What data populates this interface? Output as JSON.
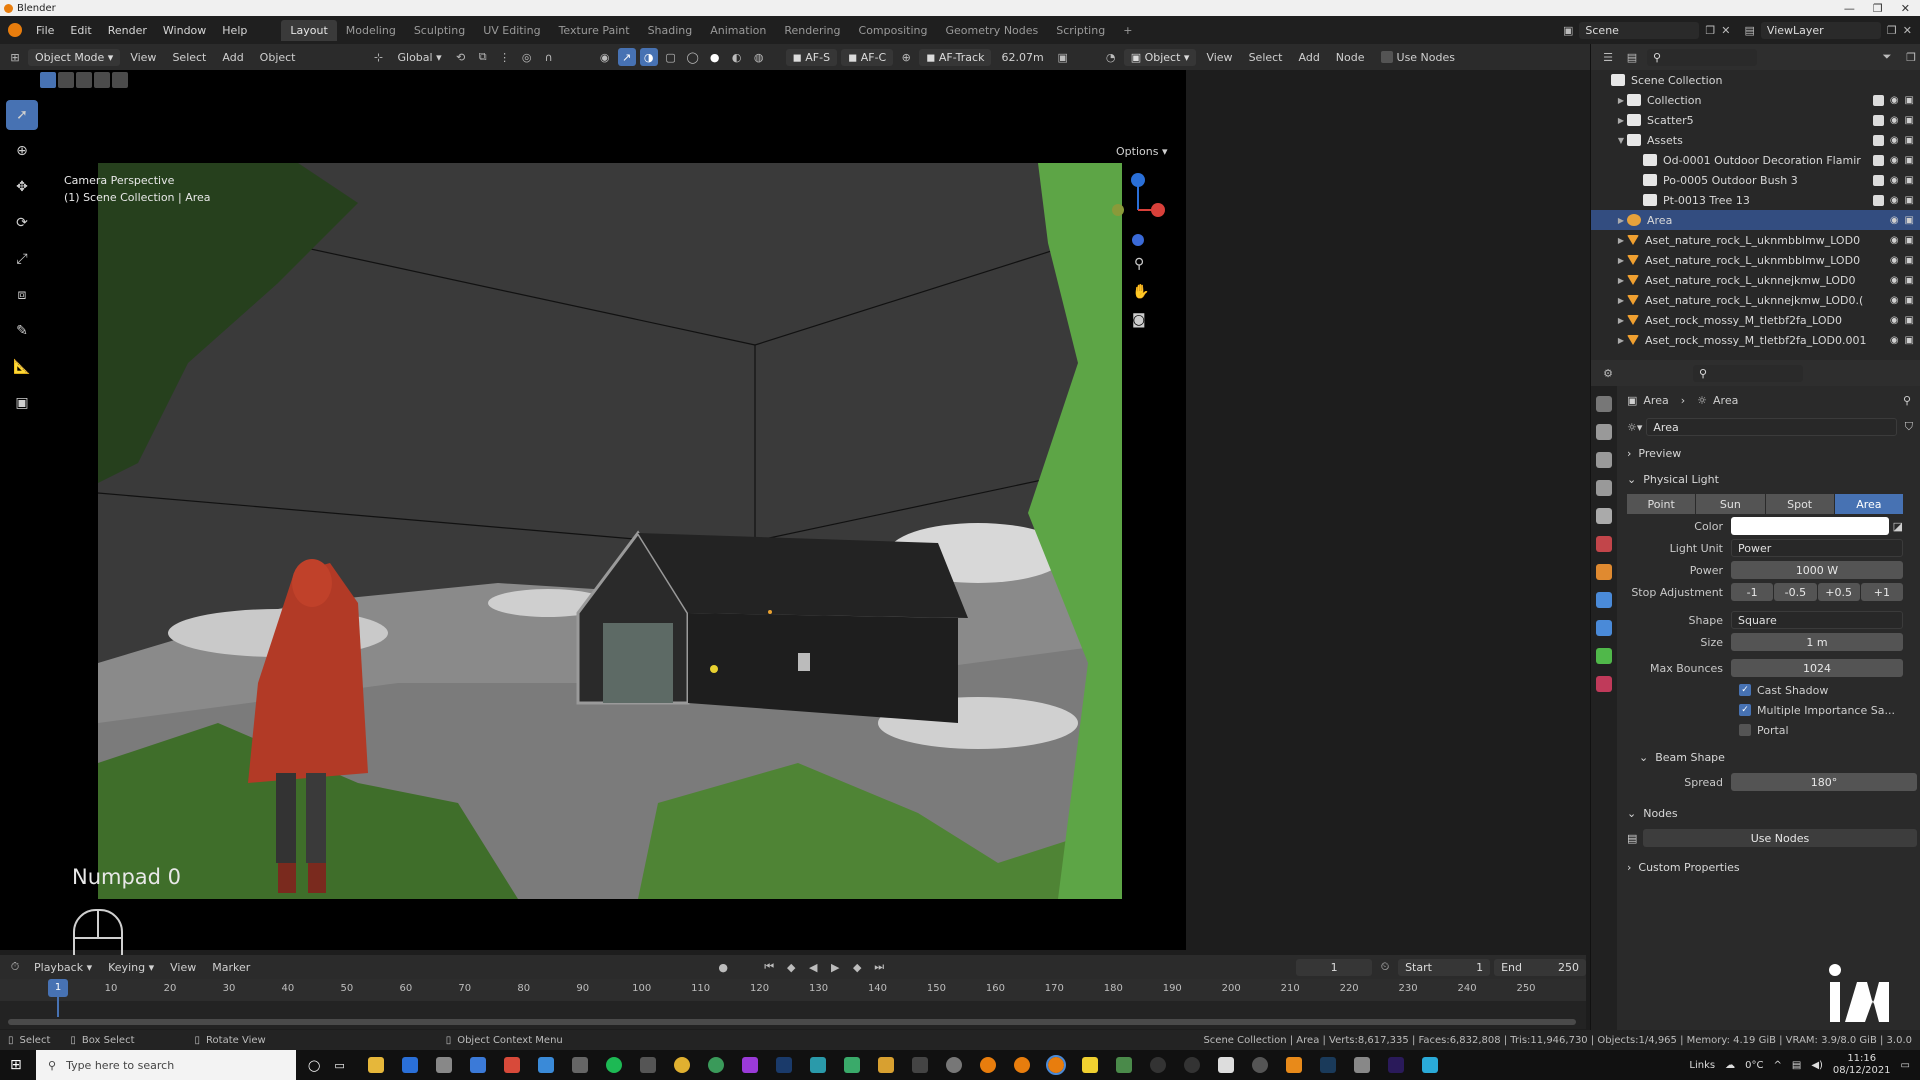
{
  "app": {
    "title": "Blender"
  },
  "menu": {
    "items": [
      "File",
      "Edit",
      "Render",
      "Window",
      "Help"
    ],
    "workspaces": [
      "Layout",
      "Modeling",
      "Sculpting",
      "UV Editing",
      "Texture Paint",
      "Shading",
      "Animation",
      "Rendering",
      "Compositing",
      "Geometry Nodes",
      "Scripting"
    ],
    "active_workspace": "Layout",
    "scene": "Scene",
    "view_layer": "ViewLayer"
  },
  "viewport_header": {
    "mode": "Object Mode",
    "menus": [
      "View",
      "Select",
      "Add",
      "Object"
    ],
    "orientation": "Global",
    "af_s": "AF-S",
    "af_c": "AF-C",
    "af_track": "AF-Track",
    "distance": "62.07m",
    "object_dropdown": "Object",
    "right_menus": [
      "View",
      "Select",
      "Add",
      "Node"
    ],
    "use_nodes": "Use Nodes",
    "options": "Options"
  },
  "viewport": {
    "line1": "Camera Perspective",
    "line2": "(1) Scene Collection | Area",
    "numpad": "Numpad 0"
  },
  "outliner": {
    "rows": [
      {
        "label": "Scene Collection",
        "depth": 0,
        "type": "collection",
        "selected": false
      },
      {
        "label": "Collection",
        "depth": 1,
        "type": "collection",
        "selected": false
      },
      {
        "label": "Scatter5",
        "depth": 1,
        "type": "collection",
        "selected": false
      },
      {
        "label": "Assets",
        "depth": 1,
        "type": "collection",
        "selected": false
      },
      {
        "label": "Od-0001 Outdoor Decoration Flamir",
        "depth": 2,
        "type": "collection",
        "selected": false
      },
      {
        "label": "Po-0005 Outdoor Bush 3",
        "depth": 2,
        "type": "collection",
        "selected": false
      },
      {
        "label": "Pt-0013 Tree 13",
        "depth": 2,
        "type": "collection",
        "selected": false
      },
      {
        "label": "Area",
        "depth": 1,
        "type": "light",
        "selected": true
      },
      {
        "label": "Aset_nature_rock_L_uknmbblmw_LOD0",
        "depth": 1,
        "type": "mesh",
        "selected": false
      },
      {
        "label": "Aset_nature_rock_L_uknmbblmw_LOD0",
        "depth": 1,
        "type": "mesh",
        "selected": false
      },
      {
        "label": "Aset_nature_rock_L_uknnejkmw_LOD0",
        "depth": 1,
        "type": "mesh",
        "selected": false
      },
      {
        "label": "Aset_nature_rock_L_uknnejkmw_LOD0.(",
        "depth": 1,
        "type": "mesh",
        "selected": false
      },
      {
        "label": "Aset_rock_mossy_M_tletbf2fa_LOD0",
        "depth": 1,
        "type": "mesh",
        "selected": false
      },
      {
        "label": "Aset_rock_mossy_M_tletbf2fa_LOD0.001",
        "depth": 1,
        "type": "mesh",
        "selected": false
      }
    ]
  },
  "properties": {
    "breadcrumb": [
      "Area",
      "Area"
    ],
    "data_name": "Area",
    "sections": {
      "preview": "Preview",
      "physical_light": "Physical Light",
      "beam_shape": "Beam Shape",
      "nodes": "Nodes",
      "custom_properties": "Custom Properties"
    },
    "light_types": [
      "Point",
      "Sun",
      "Spot",
      "Area"
    ],
    "active_light_type": "Area",
    "fields": {
      "color_label": "Color",
      "light_unit_label": "Light Unit",
      "light_unit": "Power",
      "power_label": "Power",
      "power": "1000 W",
      "stop_label": "Stop Adjustment",
      "stops": [
        "-1",
        "-0.5",
        "+0.5",
        "+1"
      ],
      "shape_label": "Shape",
      "shape": "Square",
      "size_label": "Size",
      "size": "1 m",
      "max_bounces_label": "Max Bounces",
      "max_bounces": "1024",
      "cast_shadow": "Cast Shadow",
      "mis": "Multiple Importance Sa...",
      "portal": "Portal",
      "spread_label": "Spread",
      "spread": "180°",
      "use_nodes": "Use Nodes"
    },
    "checks": {
      "cast_shadow": true,
      "mis": true,
      "portal": false
    }
  },
  "timeline": {
    "menus": [
      "Playback",
      "Keying",
      "View",
      "Marker"
    ],
    "current_frame": "1",
    "start_label": "Start",
    "start": "1",
    "end_label": "End",
    "end": "250",
    "ticks": [
      "1",
      "10",
      "20",
      "30",
      "40",
      "50",
      "60",
      "70",
      "80",
      "90",
      "100",
      "110",
      "120",
      "130",
      "140",
      "150",
      "160",
      "170",
      "180",
      "190",
      "200",
      "210",
      "220",
      "230",
      "240",
      "250"
    ]
  },
  "status": {
    "select": "Select",
    "box_select": "Box Select",
    "rotate_view": "Rotate View",
    "context_menu": "Object Context Menu",
    "stats": "Scene Collection | Area | Verts:8,617,335 | Faces:6,832,808 | Tris:11,946,730 | Objects:1/4,965 | Memory: 4.19 GiB | VRAM: 3.9/8.0 GiB | 3.0.0"
  },
  "taskbar": {
    "search": "Type here to search",
    "links": "Links",
    "temp": "0°C",
    "time": "11:16",
    "date": "08/12/2021"
  },
  "colors": {
    "accent": "#4772b3",
    "selected_row": "#334d80",
    "light_icon": "#e6a23c",
    "mesh_icon": "#f0a030"
  }
}
